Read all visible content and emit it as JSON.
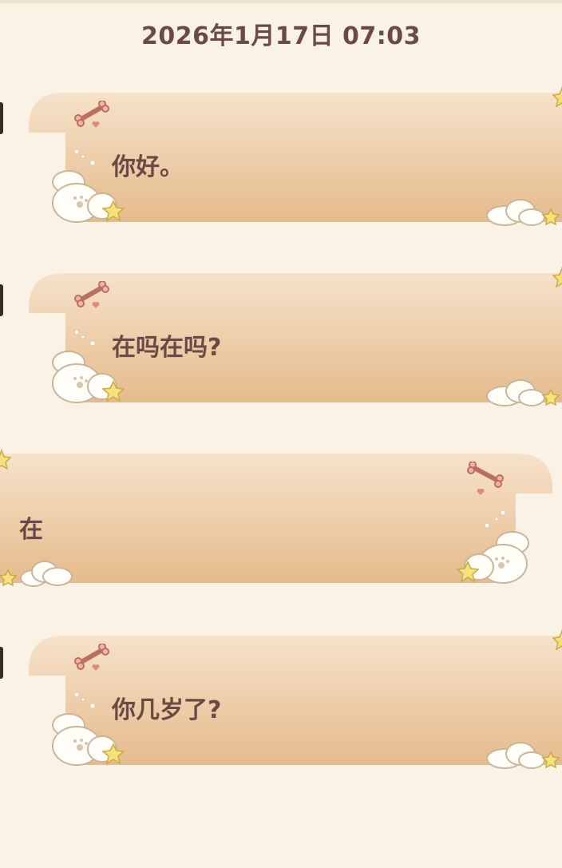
{
  "conversation": {
    "timestamp": "2026年1月17日 07:03",
    "messages": [
      {
        "direction": "incoming",
        "text": "你好。"
      },
      {
        "direction": "incoming",
        "text": "在吗在吗?"
      },
      {
        "direction": "outgoing",
        "text": "在"
      },
      {
        "direction": "incoming",
        "text": "你几岁了?"
      }
    ]
  },
  "theme": {
    "background": "#fbf2e6",
    "bubble_top": "#f5dfc5",
    "bubble_bottom": "#e6bd8f",
    "text": "#6b4a45",
    "accent_bone": "#e39686",
    "star": "#f6e27a",
    "cloud": "#fffdf8"
  }
}
